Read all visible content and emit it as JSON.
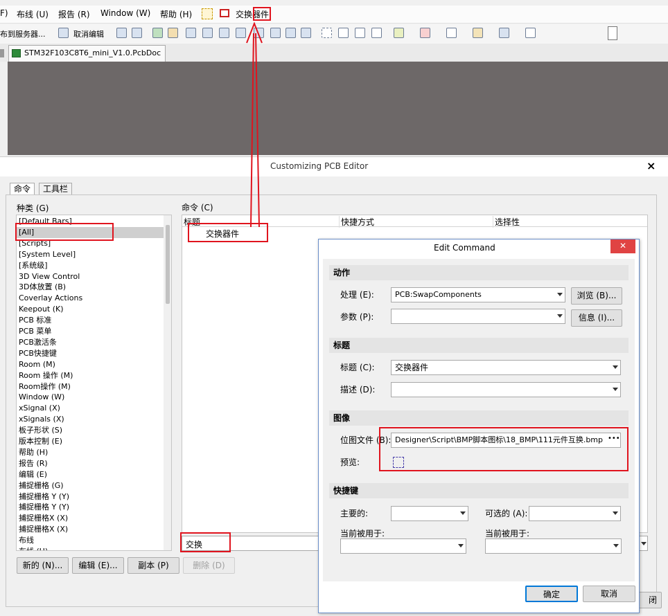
{
  "menu": {
    "item1": "布线 (U)",
    "item2": "报告 (R)",
    "item3": "Window (W)",
    "item4": "帮助 (H)",
    "item5": "交换器件",
    "partial_left": "F)"
  },
  "toolbar": {
    "publish": "布到服务器...",
    "undo_edit": "取消编辑"
  },
  "document_tab": "STM32F103C8T6_mini_V1.0.PcbDoc",
  "customize": {
    "title": "Customizing PCB Editor",
    "close_glyph": "×",
    "tabs": [
      "命令",
      "工具栏"
    ],
    "categories_label": "种类 (G)",
    "commands_label": "命令 (C)",
    "categories": [
      "[Default Bars]",
      "[All]",
      "[Scripts]",
      "[System Level]",
      "[系统级]",
      "3D View Control",
      "3D体放置 (B)",
      "Coverlay Actions",
      "Keepout (K)",
      "PCB 标准",
      "PCB 菜单",
      "PCB激活条",
      "PCB快捷键",
      "Room (M)",
      "Room 操作 (M)",
      "Room操作 (M)",
      "Window (W)",
      "xSignal (X)",
      "xSignals (X)",
      "板子形状 (S)",
      "版本控制 (E)",
      "帮助 (H)",
      "报告 (R)",
      "编辑 (E)",
      "捕捉栅格 (G)",
      "捕捉栅格 Y (Y)",
      "捕捉栅格 Y (Y)",
      "捕捉栅格X (X)",
      "捕捉栅格X (X)",
      "布线",
      "布线 (U)"
    ],
    "columns": [
      "标题",
      "快捷方式",
      "选择性"
    ],
    "command_row": "交换器件",
    "search_value": "交换",
    "buttons": {
      "new": "新的 (N)...",
      "edit": "编辑 (E)...",
      "copy": "副本 (P)",
      "delete": "删除 (D)",
      "close_partial": "闭"
    }
  },
  "edit_command": {
    "title": "Edit Command",
    "close_glyph": "✕",
    "sections": {
      "action": "动作",
      "caption": "标题",
      "image": "图像",
      "shortcut": "快捷键"
    },
    "process_label": "处理 (E):",
    "process_value": "PCB:SwapComponents",
    "browse": "浏览 (B)...",
    "params_label": "参数 (P):",
    "params_value": "",
    "info": "信息 (I)...",
    "caption_label": "标题 (C):",
    "caption_value": "交换器件",
    "desc_label": "描述 (D):",
    "desc_value": "",
    "bitmap_label": "位图文件 (B):",
    "bitmap_value": "Designer\\Script\\BMP脚本图标\\18_BMP\\111元件互换.bmp",
    "bitmap_more": "•••",
    "preview_label": "预览:",
    "primary_label": "主要的:",
    "alternate_label": "可选的 (A):",
    "used_by1": "当前被用于:",
    "used_by2": "当前被用于:",
    "ok": "确定",
    "cancel": "取消"
  },
  "colors": {
    "highlight": "#e0141e",
    "workspace": "#6d6868",
    "close_red": "#e04343"
  }
}
